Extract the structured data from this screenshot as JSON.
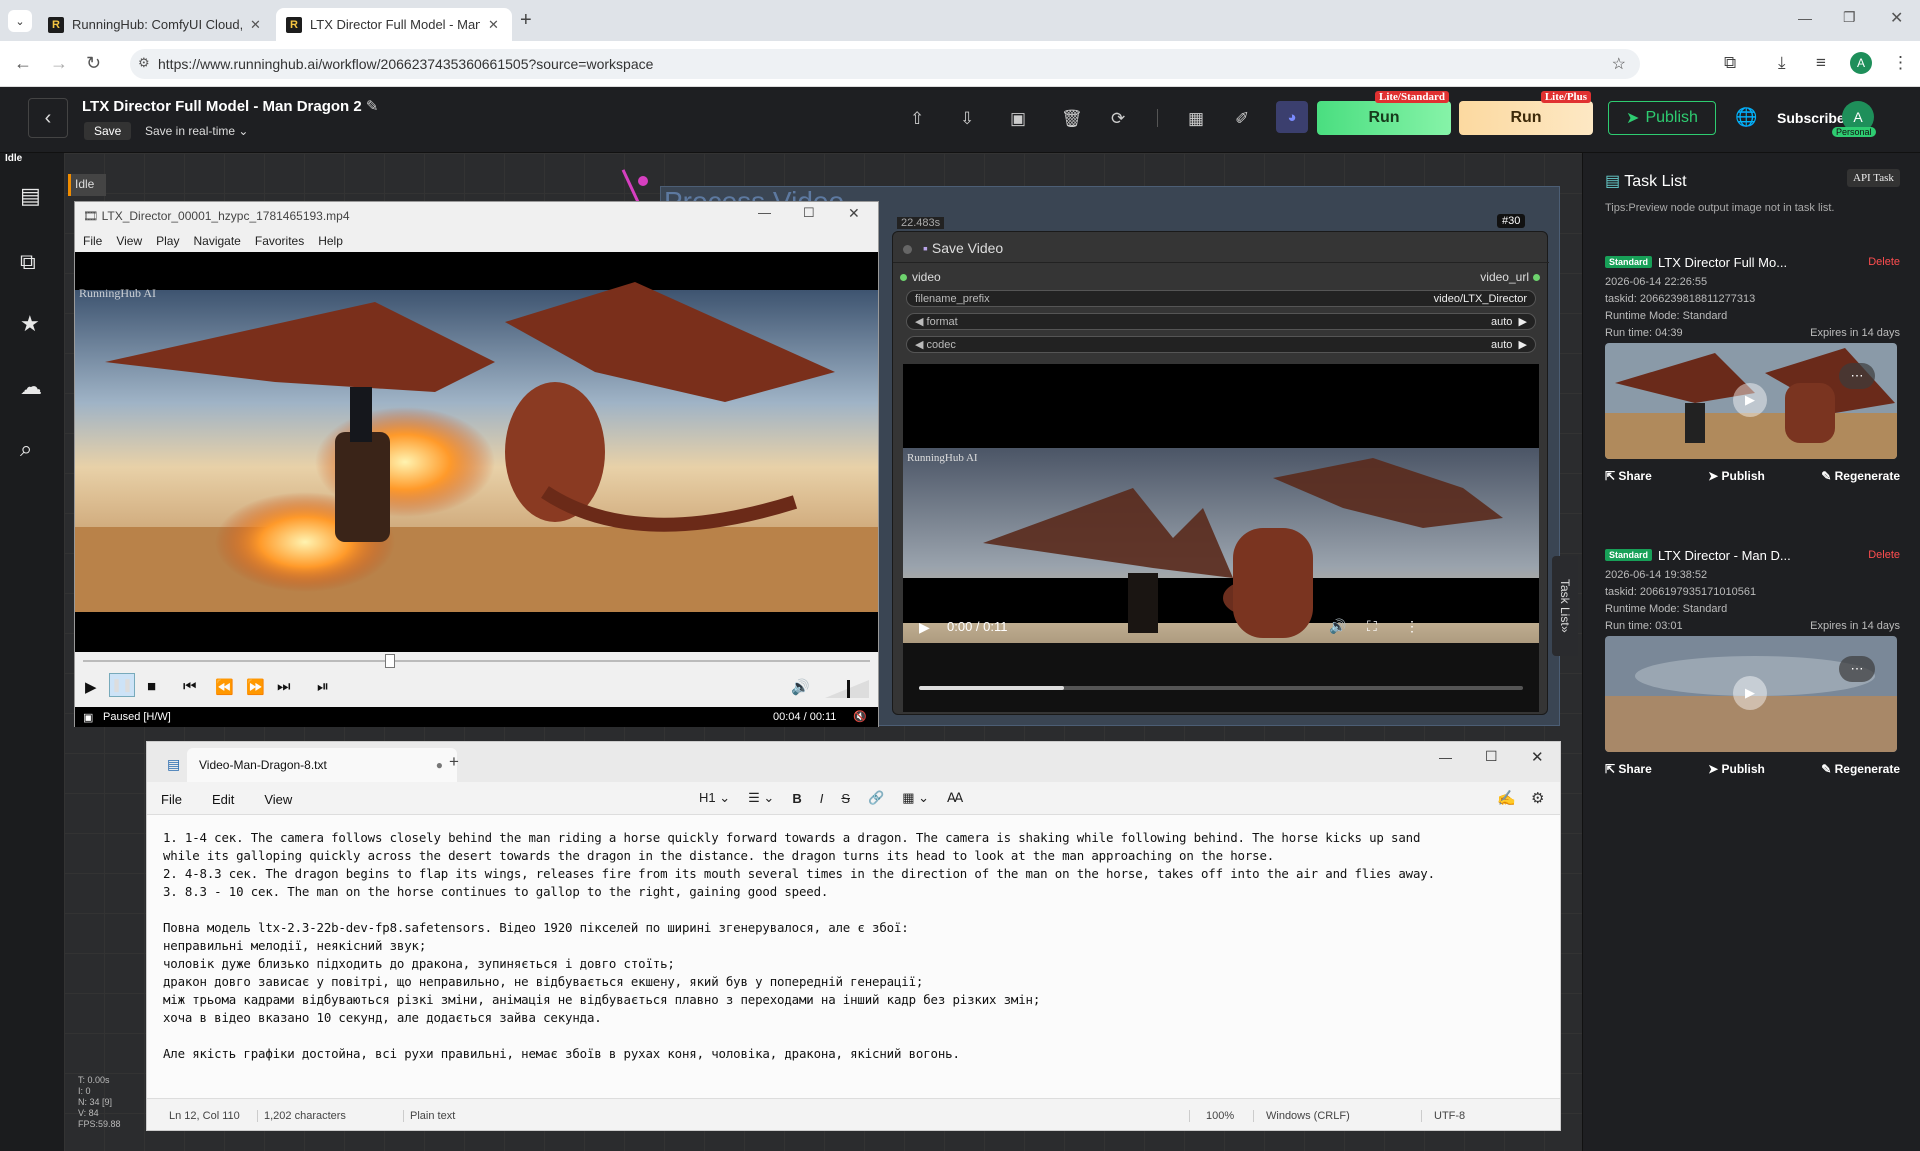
{
  "browser": {
    "tabs": [
      {
        "title": "RunningHub: ComfyUI Cloud, C",
        "active": false
      },
      {
        "title": "LTX Director Full Model - Man D",
        "active": true
      }
    ],
    "url": "https://www.runninghub.ai/workflow/2066237435360661505?source=workspace",
    "profile_initial": "A"
  },
  "header": {
    "title": "LTX Director Full Model - Man Dragon 2",
    "save_label": "Save",
    "save_mode": "Save in real-time",
    "run_standard": {
      "label": "Run",
      "tag": "Lite/Standard"
    },
    "run_plus": {
      "label": "Run",
      "tag": "Lite/Plus"
    },
    "publish_label": "Publish",
    "subscribe_label": "Subscribe",
    "avatar_initial": "A",
    "plan_badge": "Personal",
    "colors": {
      "run_standard": "#4ade80",
      "run_plus": "#fcd9a0",
      "publish": "#2ecc71"
    }
  },
  "status": {
    "state": "Idle"
  },
  "canvas": {
    "group_title": "Process Video",
    "idle_chip": "Idle",
    "stats": [
      "T: 0.00s",
      "I: 0",
      "N: 34 [9]",
      "V: 84",
      "FPS:59.88"
    ]
  },
  "player": {
    "title": "LTX_Director_00001_hzypc_1781465193.mp4",
    "menu": [
      "File",
      "View",
      "Play",
      "Navigate",
      "Favorites",
      "Help"
    ],
    "watermark": "RunningHub AI",
    "status_text": "Paused [H/W]",
    "time": "00:04 / 00:11",
    "progress": 0.39,
    "volume": 0.5
  },
  "node": {
    "elapsed": "22.483s",
    "id": "#30",
    "title": "Save Video",
    "input_label": "video",
    "output_label": "video_url",
    "widgets": [
      {
        "name": "filename_prefix",
        "value": "video/LTX_Director"
      },
      {
        "name": "format",
        "value": "auto"
      },
      {
        "name": "codec",
        "value": "auto"
      }
    ],
    "watermark": "RunningHub AI",
    "video_time": "0:00 / 0:11",
    "progress": 0.24
  },
  "tasklist": {
    "title": "Task List",
    "api_task": "API Task",
    "tip": "Tips:Preview node output image not in task list.",
    "side_tab": "Task List",
    "tasks": [
      {
        "badge": "Standard",
        "name": "LTX Director Full Mo...",
        "delete": "Delete",
        "date": "2026-06-14 22:26:55",
        "taskid": "taskid: 2066239818811277313",
        "mode": "Runtime Mode: Standard",
        "runtime": "Run time: 04:39",
        "expires": "Expires in 14 days",
        "actions": [
          "Share",
          "Publish",
          "Regenerate"
        ]
      },
      {
        "badge": "Standard",
        "name": "LTX Director - Man D...",
        "delete": "Delete",
        "date": "2026-06-14 19:38:52",
        "taskid": "taskid: 2066197935171010561",
        "mode": "Runtime Mode: Standard",
        "runtime": "Run time: 03:01",
        "expires": "Expires in 14 days",
        "actions": [
          "Share",
          "Publish",
          "Regenerate"
        ]
      }
    ]
  },
  "notepad": {
    "tab_title": "Video-Man-Dragon-8.txt",
    "menu": [
      "File",
      "Edit",
      "View"
    ],
    "heading": "H1",
    "body": "1. 1-4 сек. The camera follows closely behind the man riding a horse quickly forward towards a dragon. The camera is shaking while following behind. The horse kicks up sand\nwhile its galloping quickly across the desert towards the dragon in the distance. the dragon turns its head to look at the man approaching on the horse.\n2. 4-8.3 сек. The dragon begins to flap its wings, releases fire from its mouth several times in the direction of the man on the horse, takes off into the air and flies away.\n3. 8.3 - 10 сек. The man on the horse continues to gallop to the right, gaining good speed.\n\nПовна модель ltx-2.3-22b-dev-fp8.safetensors. Відео 1920 пікселей по ширині згенерувалося, але є збої:\nнеправильні мелодії, неякісний звук;\nчоловік дуже близько підходить до дракона, зупиняється і довго стоїть;\nдракон довго зависає у повітрі, що неправильно, не відбувається екшену, який був у попередній генерації;\nміж трьома кадрами відбуваються різкі зміни, анімація не відбувається плавно з переходами на інший кадр без різких змін;\nхоча в відео вказано 10 секунд, але додається зайва секунда.\n\nАле якість графіки достойна, всі рухи правильні, немає збоїв в рухах коня, чоловіка, дракона, якісний вогонь.",
    "status": {
      "position": "Ln 12, Col 110",
      "chars": "1,202 characters",
      "format": "Plain text",
      "zoom": "100%",
      "line_ending": "Windows (CRLF)",
      "encoding": "UTF-8"
    }
  }
}
